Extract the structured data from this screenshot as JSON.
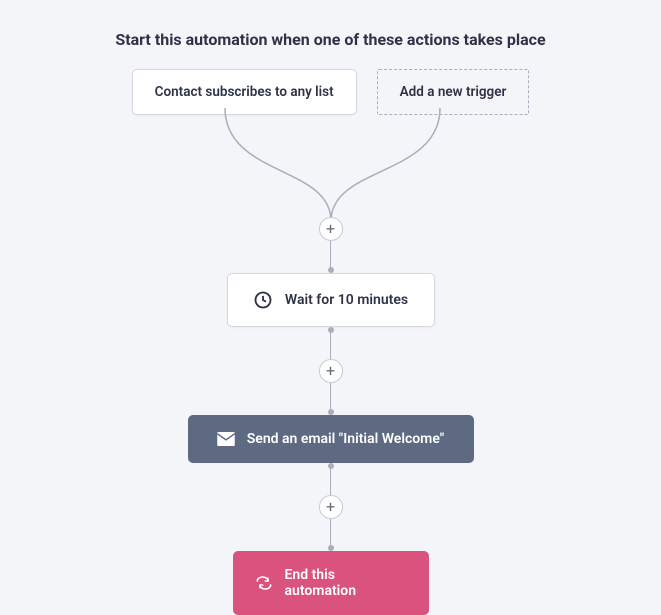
{
  "title": "Start this automation when one of these actions takes place",
  "triggers": {
    "card_label": "Contact subscribes to any list",
    "add_label": "Add a new trigger"
  },
  "plus": "+",
  "steps": {
    "wait_label": "Wait for 10 minutes",
    "email_label": "Send an email \"Initial Welcome\"",
    "end_label": "End this automation"
  }
}
